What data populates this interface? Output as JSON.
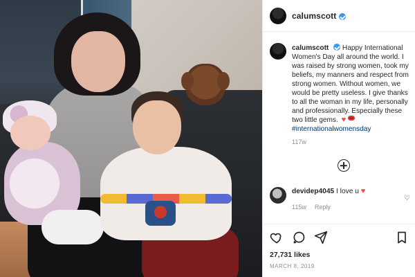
{
  "post": {
    "header": {
      "username": "calumscott",
      "verified": true
    },
    "caption": {
      "username": "calumscott",
      "text": "Happy International Women's Day all around the world. I was raised by strong women, took my beliefs, my manners and respect from strong women. Without women, we would be pretty useless. I give thanks to all the woman in my life, personally and professionally. Especially these two little gems.",
      "hashtag": "#internationalwomensday",
      "time_ago": "117w"
    },
    "comments": [
      {
        "username": "devidep4045",
        "text": "I love u",
        "time_ago": "115w",
        "reply_label": "Reply"
      }
    ],
    "actions": {
      "likes": "27,731 likes",
      "date": "MARCH 8, 2019"
    }
  }
}
